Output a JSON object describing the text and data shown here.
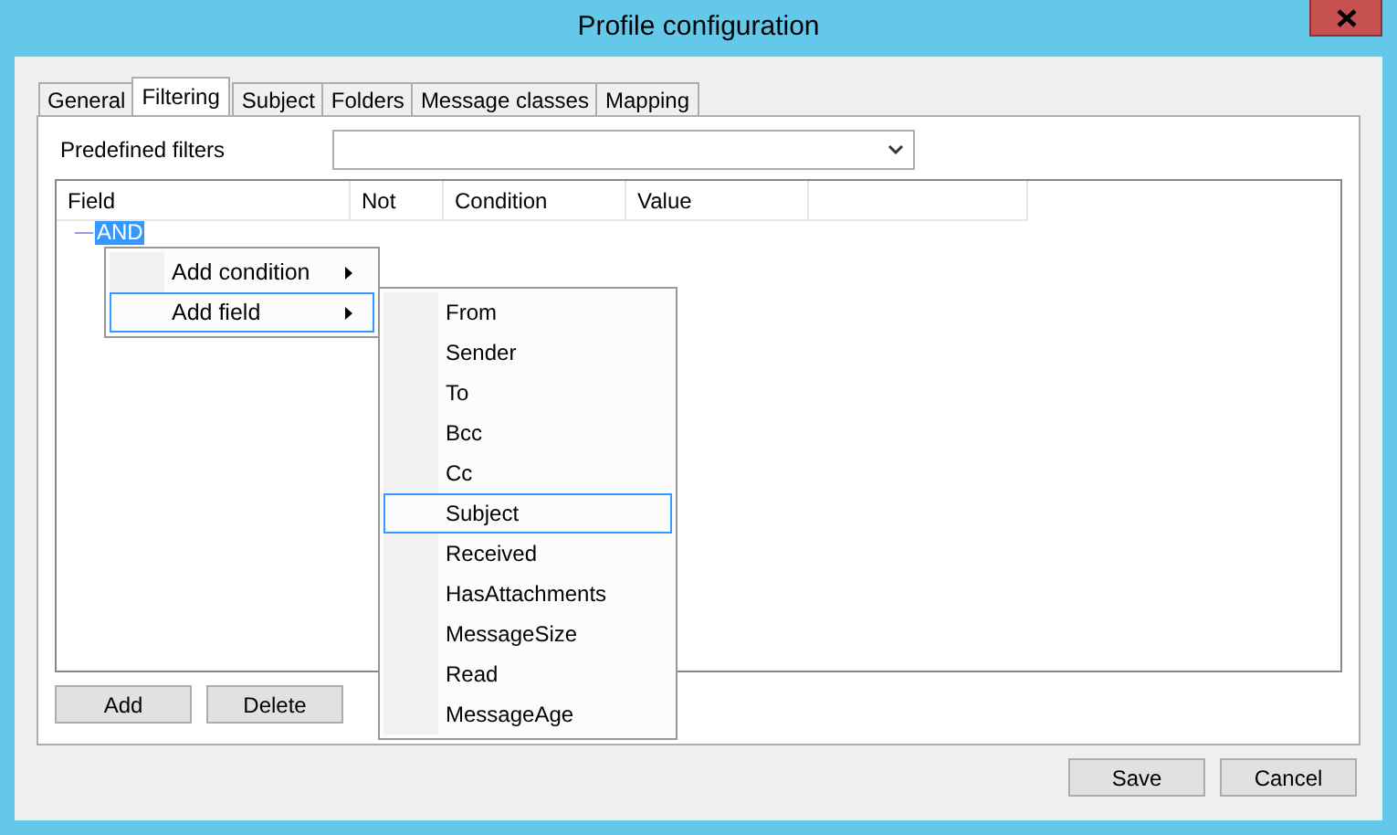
{
  "window": {
    "title": "Profile configuration"
  },
  "tabs": [
    {
      "label": "General",
      "selected": false
    },
    {
      "label": "Filtering",
      "selected": true
    },
    {
      "label": "Subject",
      "selected": false
    },
    {
      "label": "Folders",
      "selected": false
    },
    {
      "label": "Message classes",
      "selected": false
    },
    {
      "label": "Mapping",
      "selected": false
    }
  ],
  "predefined_filters": {
    "label": "Predefined filters"
  },
  "grid": {
    "columns": [
      "Field",
      "Not",
      "Condition",
      "Value"
    ],
    "tree": [
      {
        "label": "AND",
        "selected": true
      }
    ]
  },
  "grid_buttons": [
    "Add",
    "Delete"
  ],
  "context_menu": [
    {
      "label": "Add condition",
      "has_submenu": true,
      "selected": false
    },
    {
      "label": "Add field",
      "has_submenu": true,
      "selected": true
    }
  ],
  "submenu": [
    {
      "label": "From",
      "selected": false
    },
    {
      "label": "Sender",
      "selected": false
    },
    {
      "label": "To",
      "selected": false
    },
    {
      "label": "Bcc",
      "selected": false
    },
    {
      "label": "Cc",
      "selected": false
    },
    {
      "label": "Subject",
      "selected": true
    },
    {
      "label": "Received",
      "selected": false
    },
    {
      "label": "HasAttachments",
      "selected": false
    },
    {
      "label": "MessageSize",
      "selected": false
    },
    {
      "label": "Read",
      "selected": false
    },
    {
      "label": "MessageAge",
      "selected": false
    }
  ],
  "dialog_buttons": [
    "Save",
    "Cancel"
  ]
}
